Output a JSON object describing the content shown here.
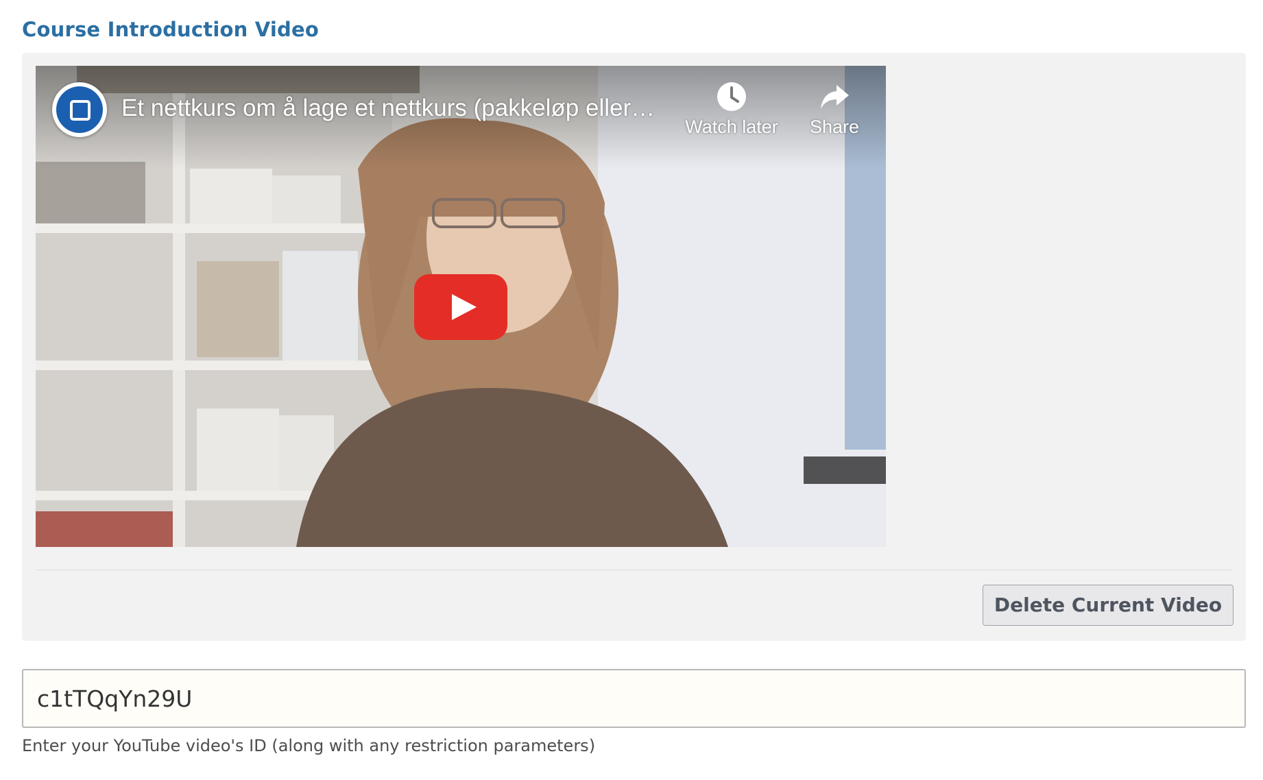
{
  "section": {
    "title": "Course Introduction Video"
  },
  "player": {
    "video_title": "Et nettkurs om å lage et nettkurs (pakkeløp eller…",
    "watch_later_label": "Watch later",
    "share_label": "Share",
    "play_icon": "youtube-play-icon",
    "colors": {
      "play_button": "#e52d27",
      "channel_avatar": "#1b5fb0"
    }
  },
  "actions": {
    "delete_label": "Delete Current Video"
  },
  "video_id_field": {
    "value": "c1tTQqYn29U",
    "help_text": "Enter your YouTube video's ID (along with any restriction parameters)"
  },
  "colors": {
    "title": "#2b6fa3",
    "panel_background": "#f2f2f2",
    "input_background": "#fffdf8"
  }
}
